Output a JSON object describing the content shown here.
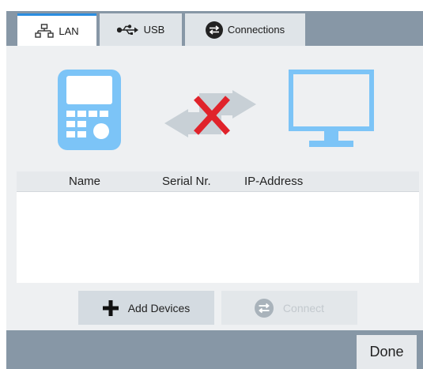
{
  "tabs": [
    {
      "label": "LAN",
      "icon": "network-icon",
      "active": true
    },
    {
      "label": "USB",
      "icon": "usb-icon",
      "active": false
    },
    {
      "label": "Connections",
      "icon": "swap-arrows-icon",
      "active": false
    }
  ],
  "status": {
    "device_icon": "handheld-device-icon",
    "link_icon": "disconnected-arrows-icon",
    "target_icon": "monitor-icon",
    "connected": false
  },
  "table": {
    "columns": [
      "Name",
      "Serial Nr.",
      "IP-Address"
    ],
    "rows": []
  },
  "actions": {
    "add_label": "Add Devices",
    "connect_label": "Connect",
    "connect_enabled": false
  },
  "footer": {
    "done_label": "Done"
  },
  "colors": {
    "accent": "#2a8de0",
    "icon_blue": "#7cc4f7",
    "error_red": "#e0232b",
    "bar_gray": "#8797a6"
  }
}
